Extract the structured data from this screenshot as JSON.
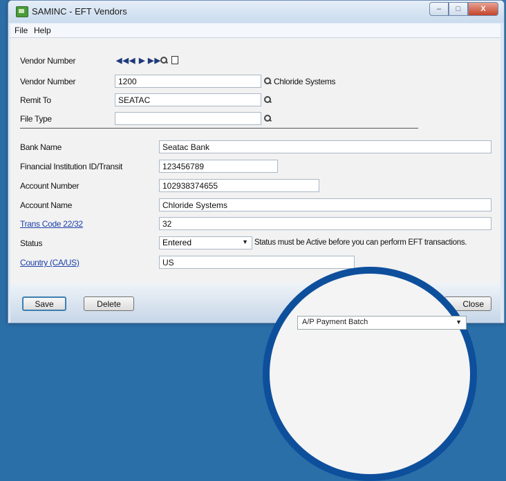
{
  "window": {
    "title": "SAMINC - EFT Vendors",
    "min": "–",
    "max": "□",
    "close": "X"
  },
  "menu": {
    "file": "File",
    "help": "Help"
  },
  "nav_label": "Vendor Number",
  "nav_buttons": {
    "first": "◀◀",
    "prev": "◀",
    "next": "▶",
    "last": "▶▶"
  },
  "vendor_number": {
    "label": "Vendor Number",
    "value": "1200",
    "description": "Chloride Systems"
  },
  "remit_to": {
    "label": "Remit To",
    "value": "SEATAC"
  },
  "file_type": {
    "label": "File Type",
    "value": ""
  },
  "bank_name": {
    "label": "Bank Name",
    "value": "Seatac Bank"
  },
  "fi_id": {
    "label": "Financial Institution ID/Transit",
    "value": "123456789"
  },
  "account_number": {
    "label": "Account Number",
    "value": "102938374655"
  },
  "account_name": {
    "label": "Account Name",
    "value": "Chloride Systems"
  },
  "trans_code": {
    "label": "Trans Code 22/32",
    "value": "32"
  },
  "status": {
    "label": "Status",
    "value": "Entered",
    "note": "Status must be Active before you can perform EFT transactions."
  },
  "country": {
    "label": "Country (CA/US)",
    "value": "US"
  },
  "buttons": {
    "save": "Save",
    "delete": "Delete",
    "close": "Close"
  },
  "popup": {
    "select_value": "A/P Payment Batch"
  },
  "colors": {
    "accent": "#0e4f9c",
    "link": "#1a3fa8"
  }
}
